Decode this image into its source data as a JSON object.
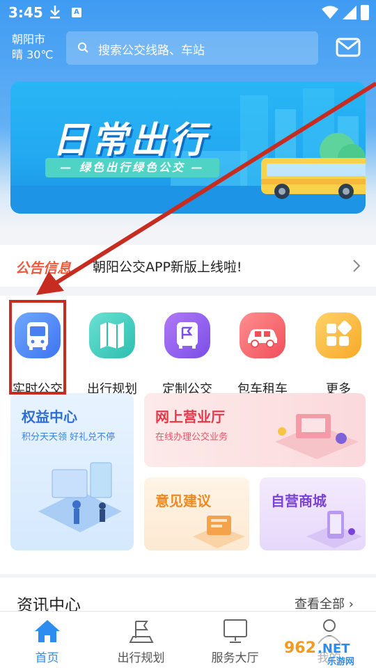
{
  "status_bar": {
    "time": "3:45",
    "a_badge": "A"
  },
  "header": {
    "city": "朝阳市",
    "weather": "晴 30℃",
    "search_placeholder": "搜索公交线路、车站"
  },
  "banner": {
    "title": "日常出行",
    "subtitle": "— 绿色出行绿色公交 —"
  },
  "notice": {
    "tag": "公告信息",
    "text": "朝阳公交APP新版上线啦!"
  },
  "quick_menu": [
    {
      "label": "实时公交",
      "icon": "bus-icon"
    },
    {
      "label": "出行规划",
      "icon": "map-icon"
    },
    {
      "label": "定制公交",
      "icon": "custom-bus-icon"
    },
    {
      "label": "包车租车",
      "icon": "car-icon"
    },
    {
      "label": "更多",
      "icon": "grid-icon"
    }
  ],
  "cards": {
    "rights": {
      "title": "权益中心",
      "sub": "积分天天领 好礼兑不停"
    },
    "online_hall": {
      "title": "网上营业厅",
      "sub": "在线办理公交业务"
    },
    "feedback": {
      "title": "意见建议"
    },
    "mall": {
      "title": "自营商城"
    }
  },
  "news": {
    "title": "资讯中心",
    "more": "查看全部"
  },
  "bottom_nav": [
    {
      "label": "首页",
      "icon": "home-icon"
    },
    {
      "label": "出行规划",
      "icon": "route-flag-icon"
    },
    {
      "label": "服务大厅",
      "icon": "monitor-icon"
    },
    {
      "label": "我的",
      "icon": "user-icon"
    }
  ],
  "watermark": {
    "brand": "962",
    "suffix": ".NET",
    "sub": "乐游网"
  },
  "colors": {
    "primary": "#3f9bf2",
    "accent_red": "#ef5a3c",
    "highlight": "#c72c20",
    "nav_active": "#2d8cf0"
  }
}
